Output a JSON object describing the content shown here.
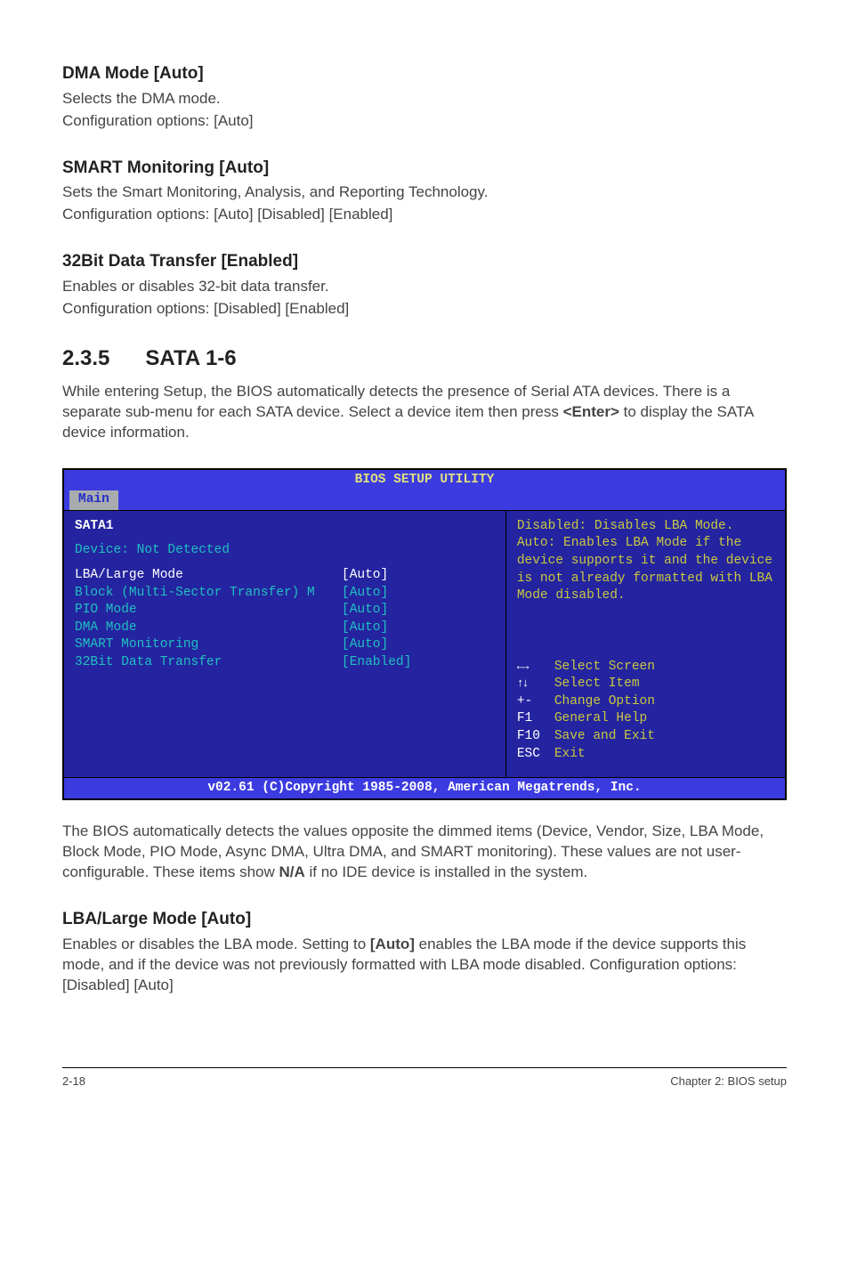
{
  "sections": {
    "dma_mode": {
      "title": "DMA Mode [Auto]",
      "line1": "Selects the DMA mode.",
      "line2": "Configuration options: [Auto]"
    },
    "smart_monitoring": {
      "title": "SMART Monitoring [Auto]",
      "line1": "Sets the Smart Monitoring, Analysis, and Reporting Technology.",
      "line2": "Configuration options: [Auto] [Disabled] [Enabled]"
    },
    "data_transfer": {
      "title": "32Bit Data Transfer [Enabled]",
      "line1": "Enables or disables 32-bit data transfer.",
      "line2": "Configuration options: [Disabled] [Enabled]"
    },
    "sata": {
      "num": "2.3.5",
      "title": "SATA 1-6",
      "intro_a": "While entering Setup, the BIOS automatically detects the presence of Serial ATA devices. There is a separate sub-menu for each SATA device. Select a device item then press ",
      "intro_key": "<Enter>",
      "intro_b": " to display the SATA device information."
    },
    "post_bios": {
      "para_a": "The BIOS automatically detects the values opposite the dimmed items (Device, Vendor, Size, LBA Mode, Block Mode, PIO Mode, Async DMA, Ultra DMA, and SMART monitoring). These values are not user-configurable. These items show ",
      "para_bold": "N/A",
      "para_b": " if no IDE device is installed in the system."
    },
    "lba_large": {
      "title": "LBA/Large Mode [Auto]",
      "line_a": "Enables or disables the LBA mode. Setting to ",
      "line_bold": "[Auto]",
      "line_b": " enables the LBA mode if the device supports this mode, and if the device was not previously formatted with LBA mode disabled. Configuration options: [Disabled] [Auto]"
    }
  },
  "bios": {
    "title": "BIOS SETUP UTILITY",
    "tab": "Main",
    "left": {
      "sata": "SATA1",
      "device": "Device: Not Detected",
      "rows": [
        {
          "label": "LBA/Large Mode",
          "value": "[Auto]",
          "selected": true
        },
        {
          "label": "Block (Multi-Sector Transfer) M",
          "value": "[Auto]",
          "selected": false
        },
        {
          "label": "PIO Mode",
          "value": "[Auto]",
          "selected": false
        },
        {
          "label": "DMA Mode",
          "value": "[Auto]",
          "selected": false
        },
        {
          "label": "SMART Monitoring",
          "value": "[Auto]",
          "selected": false
        },
        {
          "label": "32Bit Data Transfer",
          "value": "[Enabled]",
          "selected": false
        }
      ]
    },
    "right": {
      "help": "Disabled: Disables LBA Mode.\nAuto: Enables LBA Mode if the device supports it and the device is not already formatted with LBA Mode disabled.",
      "keys": [
        {
          "key": "←→",
          "label": "Select Screen",
          "arrows": true
        },
        {
          "key": "↑↓",
          "label": "Select Item",
          "arrows": true
        },
        {
          "key": "+-",
          "label": "Change Option"
        },
        {
          "key": "F1",
          "label": "General Help"
        },
        {
          "key": "F10",
          "label": "Save and Exit"
        },
        {
          "key": "ESC",
          "label": "Exit"
        }
      ]
    },
    "footer": "v02.61 (C)Copyright 1985-2008, American Megatrends, Inc."
  },
  "page_footer": {
    "left": "2-18",
    "right": "Chapter 2: BIOS setup"
  }
}
